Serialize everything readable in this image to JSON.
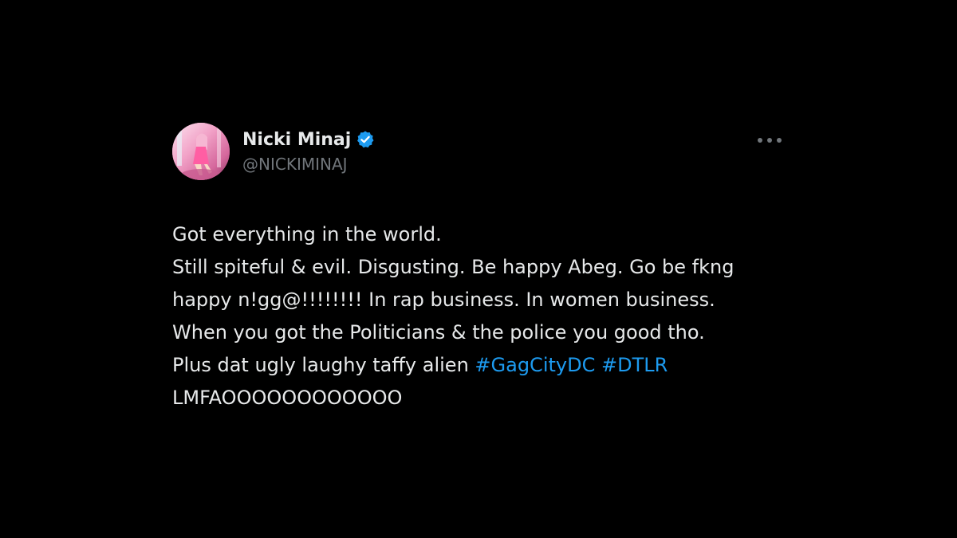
{
  "tweet": {
    "author": {
      "display_name": "Nicki Minaj",
      "handle": "@NICKIMINAJ",
      "verified_icon": "verified-badge-icon",
      "avatar_icon": "avatar-image"
    },
    "menu_icon": "more-options-icon",
    "lines": {
      "l1": "Got everything in the world.",
      "l2": "Still spiteful & evil. Disgusting. Be happy Abeg. Go be fkng",
      "l3": "happy n!gg@!!!!!!!! In rap business. In women business.",
      "l4": "When you got the Politicians & the police you good tho.",
      "l5_text": "Plus dat ugly laughy taffy alien ",
      "l6": "LMFAOOOOOOOOOOOO"
    },
    "hashtags": {
      "h1": "#GagCityDC",
      "h2": "#DTLR"
    },
    "colors": {
      "background": "#000000",
      "text": "#e7e9ea",
      "secondary": "#71767b",
      "link": "#1d9bf0",
      "verified": "#1d9bf0"
    }
  }
}
